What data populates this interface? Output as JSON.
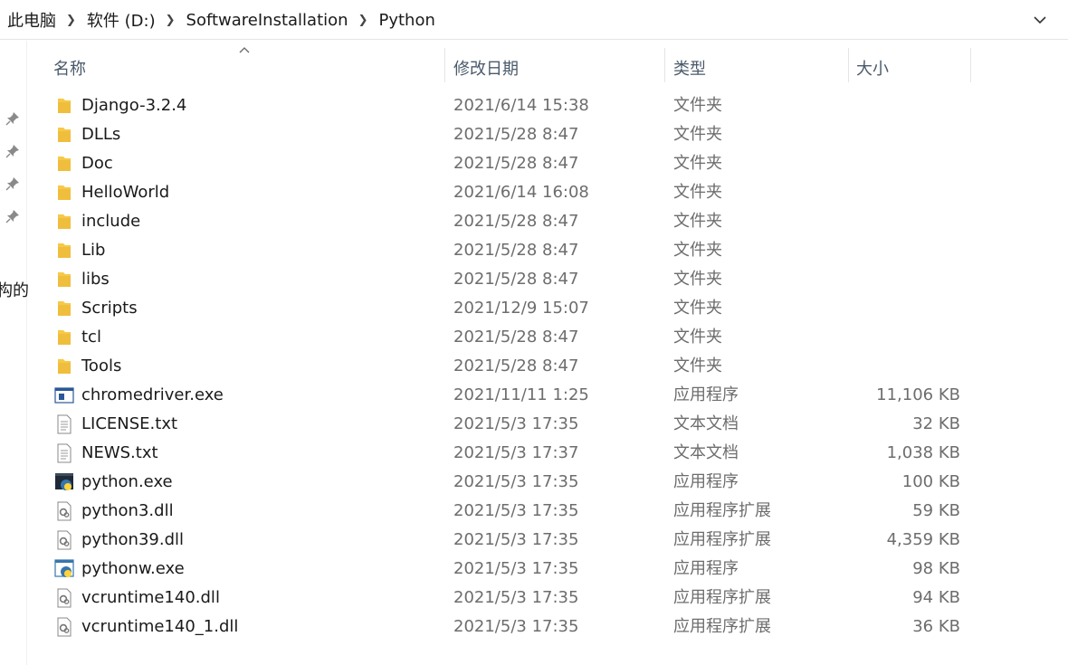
{
  "breadcrumb": [
    "此电脑",
    "软件 (D:)",
    "SoftwareInstallation",
    "Python"
  ],
  "nav_cut_text": "构的",
  "headers": {
    "name": "名称",
    "date": "修改日期",
    "type": "类型",
    "size": "大小"
  },
  "colors": {
    "folder": "#f7c948",
    "folder_dark": "#e2a92a",
    "header_text": "#4a5a6a",
    "meta_text": "#6d6d6d"
  },
  "files": [
    {
      "name": "Django-3.2.4",
      "date": "2021/6/14 15:38",
      "type": "文件夹",
      "size": "",
      "icon": "folder-icon"
    },
    {
      "name": "DLLs",
      "date": "2021/5/28 8:47",
      "type": "文件夹",
      "size": "",
      "icon": "folder-icon"
    },
    {
      "name": "Doc",
      "date": "2021/5/28 8:47",
      "type": "文件夹",
      "size": "",
      "icon": "folder-icon"
    },
    {
      "name": "HelloWorld",
      "date": "2021/6/14 16:08",
      "type": "文件夹",
      "size": "",
      "icon": "folder-icon"
    },
    {
      "name": "include",
      "date": "2021/5/28 8:47",
      "type": "文件夹",
      "size": "",
      "icon": "folder-icon"
    },
    {
      "name": "Lib",
      "date": "2021/5/28 8:47",
      "type": "文件夹",
      "size": "",
      "icon": "folder-icon"
    },
    {
      "name": "libs",
      "date": "2021/5/28 8:47",
      "type": "文件夹",
      "size": "",
      "icon": "folder-icon"
    },
    {
      "name": "Scripts",
      "date": "2021/12/9 15:07",
      "type": "文件夹",
      "size": "",
      "icon": "folder-icon"
    },
    {
      "name": "tcl",
      "date": "2021/5/28 8:47",
      "type": "文件夹",
      "size": "",
      "icon": "folder-icon"
    },
    {
      "name": "Tools",
      "date": "2021/5/28 8:47",
      "type": "文件夹",
      "size": "",
      "icon": "folder-icon"
    },
    {
      "name": "chromedriver.exe",
      "date": "2021/11/11 1:25",
      "type": "应用程序",
      "size": "11,106 KB",
      "icon": "exe-icon"
    },
    {
      "name": "LICENSE.txt",
      "date": "2021/5/3 17:35",
      "type": "文本文档",
      "size": "32 KB",
      "icon": "text-file-icon"
    },
    {
      "name": "NEWS.txt",
      "date": "2021/5/3 17:37",
      "type": "文本文档",
      "size": "1,038 KB",
      "icon": "text-file-icon"
    },
    {
      "name": "python.exe",
      "date": "2021/5/3 17:35",
      "type": "应用程序",
      "size": "100 KB",
      "icon": "python-exe-icon"
    },
    {
      "name": "python3.dll",
      "date": "2021/5/3 17:35",
      "type": "应用程序扩展",
      "size": "59 KB",
      "icon": "dll-icon"
    },
    {
      "name": "python39.dll",
      "date": "2021/5/3 17:35",
      "type": "应用程序扩展",
      "size": "4,359 KB",
      "icon": "dll-icon"
    },
    {
      "name": "pythonw.exe",
      "date": "2021/5/3 17:35",
      "type": "应用程序",
      "size": "98 KB",
      "icon": "pythonw-exe-icon"
    },
    {
      "name": "vcruntime140.dll",
      "date": "2021/5/3 17:35",
      "type": "应用程序扩展",
      "size": "94 KB",
      "icon": "dll-icon"
    },
    {
      "name": "vcruntime140_1.dll",
      "date": "2021/5/3 17:35",
      "type": "应用程序扩展",
      "size": "36 KB",
      "icon": "dll-icon"
    }
  ]
}
